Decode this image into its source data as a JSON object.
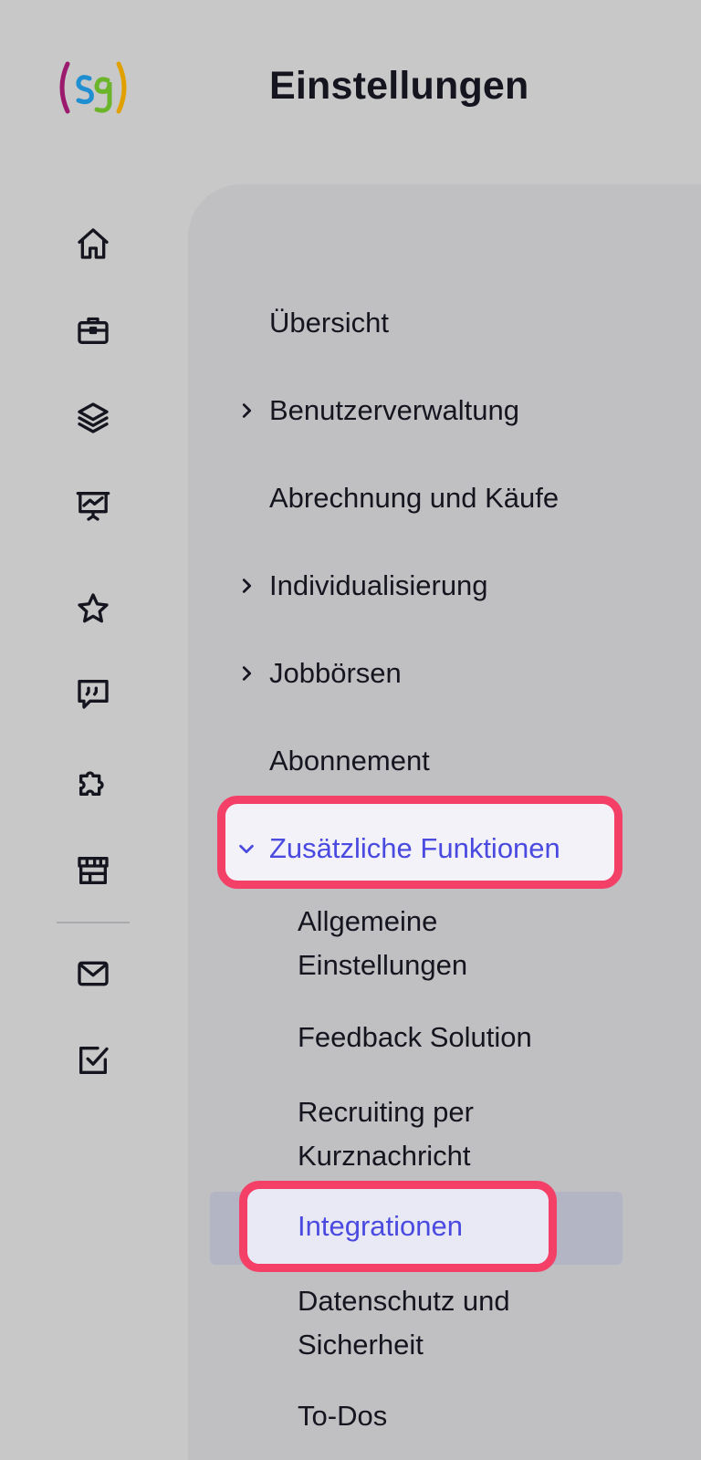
{
  "header": {
    "logo_text": "(sg)",
    "title": "Einstellungen"
  },
  "rail": {
    "icons": [
      "home-icon",
      "briefcase-icon",
      "layers-icon",
      "presentation-chart-icon",
      "star-icon",
      "quote-chat-icon",
      "puzzle-icon",
      "store-icon",
      "mail-icon",
      "checkbox-icon"
    ]
  },
  "settings_nav": {
    "items": [
      {
        "label": "Übersicht"
      },
      {
        "label": "Benutzerverwaltung"
      },
      {
        "label": "Abrechnung und Käufe"
      },
      {
        "label": "Individualisierung"
      },
      {
        "label": "Jobbörsen"
      },
      {
        "label": "Abonnement"
      },
      {
        "label": "Zusätzliche Funktionen"
      }
    ],
    "sub_items": [
      {
        "label_line1": "Allgemeine",
        "label_line2": "Einstellungen"
      },
      {
        "label_line1": "Feedback Solution"
      },
      {
        "label_line1": "Recruiting per",
        "label_line2": "Kurznachricht"
      },
      {
        "label_line1": "Integrationen"
      },
      {
        "label_line1": "Datenschutz und",
        "label_line2": "Sicherheit"
      },
      {
        "label_line1": "To-Dos"
      }
    ]
  },
  "colors": {
    "accent": "#4a4ae0",
    "highlight_border": "#f43f67",
    "background": "#c8c8c8",
    "panel": "#c0c0c3"
  }
}
